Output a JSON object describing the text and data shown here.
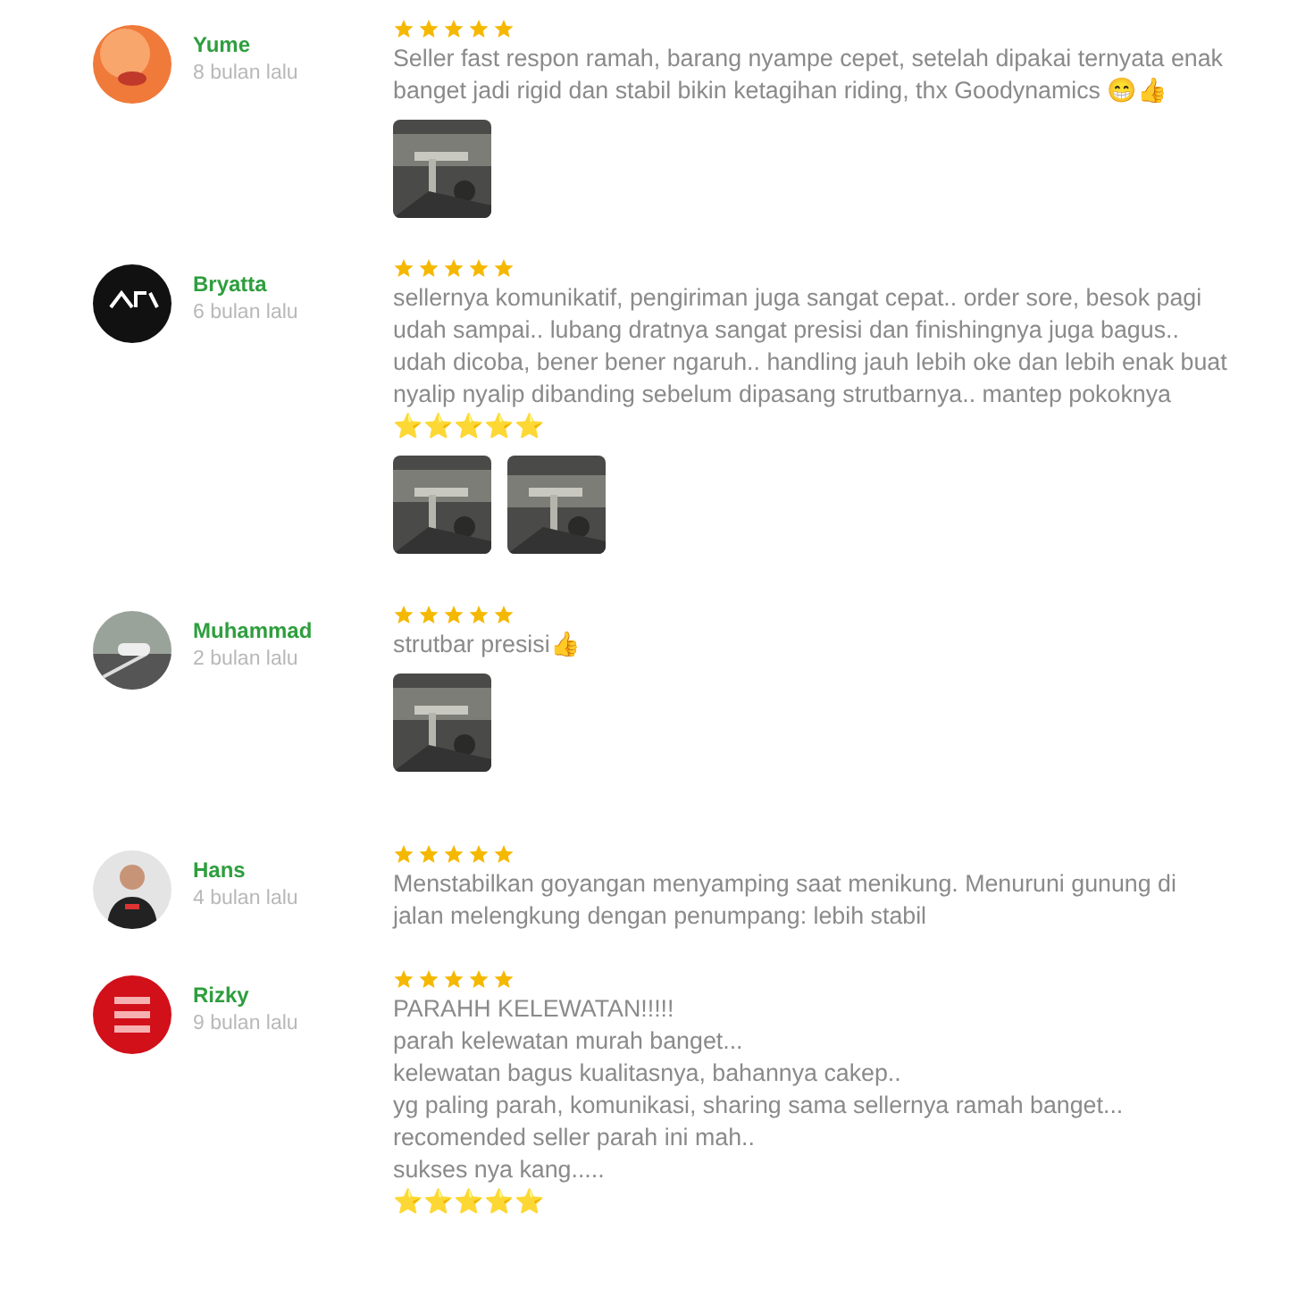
{
  "reviews": [
    {
      "name": "Yume",
      "time": "8 bulan lalu",
      "avatar": {
        "kind": "picture"
      },
      "stars": 5,
      "lines": [
        "Seller fast respon ramah, barang nyampe cepet, setelah dipakai ternyata enak banget jadi rigid dan stabil bikin ketagihan riding, thx Goodynamics 😁👍"
      ],
      "photos": [
        {
          "kind": "picture"
        }
      ]
    },
    {
      "name": "Bryatta",
      "time": "6 bulan lalu",
      "avatar": {
        "kind": "picture"
      },
      "stars": 5,
      "lines": [
        "sellernya komunikatif, pengiriman juga sangat cepat.. order sore, besok pagi udah sampai.. lubang dratnya sangat presisi dan finishingnya juga bagus.. udah dicoba, bener bener ngaruh.. handling jauh lebih oke dan lebih enak buat nyalip nyalip dibanding sebelum dipasang strutbarnya.. mantep pokoknya",
        "⭐⭐⭐⭐⭐"
      ],
      "photos": [
        {
          "kind": "picture"
        },
        {
          "kind": "picture"
        }
      ]
    },
    {
      "name": "Muhammad",
      "time": "2 bulan lalu",
      "avatar": {
        "kind": "picture"
      },
      "stars": 5,
      "lines": [
        "strutbar presisi👍"
      ],
      "photos": [
        {
          "kind": "picture"
        }
      ]
    },
    {
      "name": "Hans",
      "time": "4 bulan lalu",
      "avatar": {
        "kind": "picture"
      },
      "stars": 5,
      "lines": [
        "Menstabilkan goyangan menyamping saat menikung. Menuruni gunung di jalan melengkung dengan penumpang: lebih stabil"
      ]
    },
    {
      "name": "Rizky",
      "time": "9 bulan lalu",
      "avatar": {
        "kind": "picture"
      },
      "stars": 5,
      "lines": [
        "PARAHH KELEWATAN!!!!!",
        "parah kelewatan murah banget...",
        "kelewatan bagus kualitasnya, bahannya cakep..",
        "yg paling parah, komunikasi, sharing sama sellernya ramah banget...",
        "recomended seller parah ini mah..",
        "sukses nya kang.....",
        "⭐⭐⭐⭐⭐"
      ]
    }
  ]
}
